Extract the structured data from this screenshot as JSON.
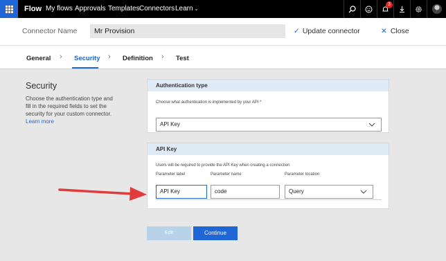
{
  "nav": {
    "brand": "Flow",
    "links": [
      "My flows",
      "Approvals",
      "Templates",
      "Connectors",
      "Learn"
    ],
    "notifications_count": "3"
  },
  "connector": {
    "name_label": "Connector Name",
    "name_value": "Mr Provision",
    "update_label": "Update connector",
    "close_label": "Close"
  },
  "tabs": [
    "General",
    "Security",
    "Definition",
    "Test"
  ],
  "active_tab": "Security",
  "side": {
    "title": "Security",
    "description": "Choose the authentication type and fill in the required fields to set the security for your custom connector.",
    "learn_more": "Learn more"
  },
  "auth": {
    "heading": "Authentication type",
    "label": "Choose what authentication is implemented by your API *",
    "value": "API Key"
  },
  "api_key": {
    "heading": "API Key",
    "note": "Users will be required to provide the API Key when creating a connection",
    "col_label": "Parameter label",
    "col_name": "Parameter name",
    "col_location": "Parameter location",
    "label_value": "API Key",
    "name_value": "code",
    "location_value": "Query"
  },
  "buttons": {
    "edit": "Edit",
    "continue": "Continue"
  },
  "colors": {
    "accent": "#1f66d6",
    "nav_bg": "#000000",
    "annotation_arrow": "#e23b3b"
  }
}
